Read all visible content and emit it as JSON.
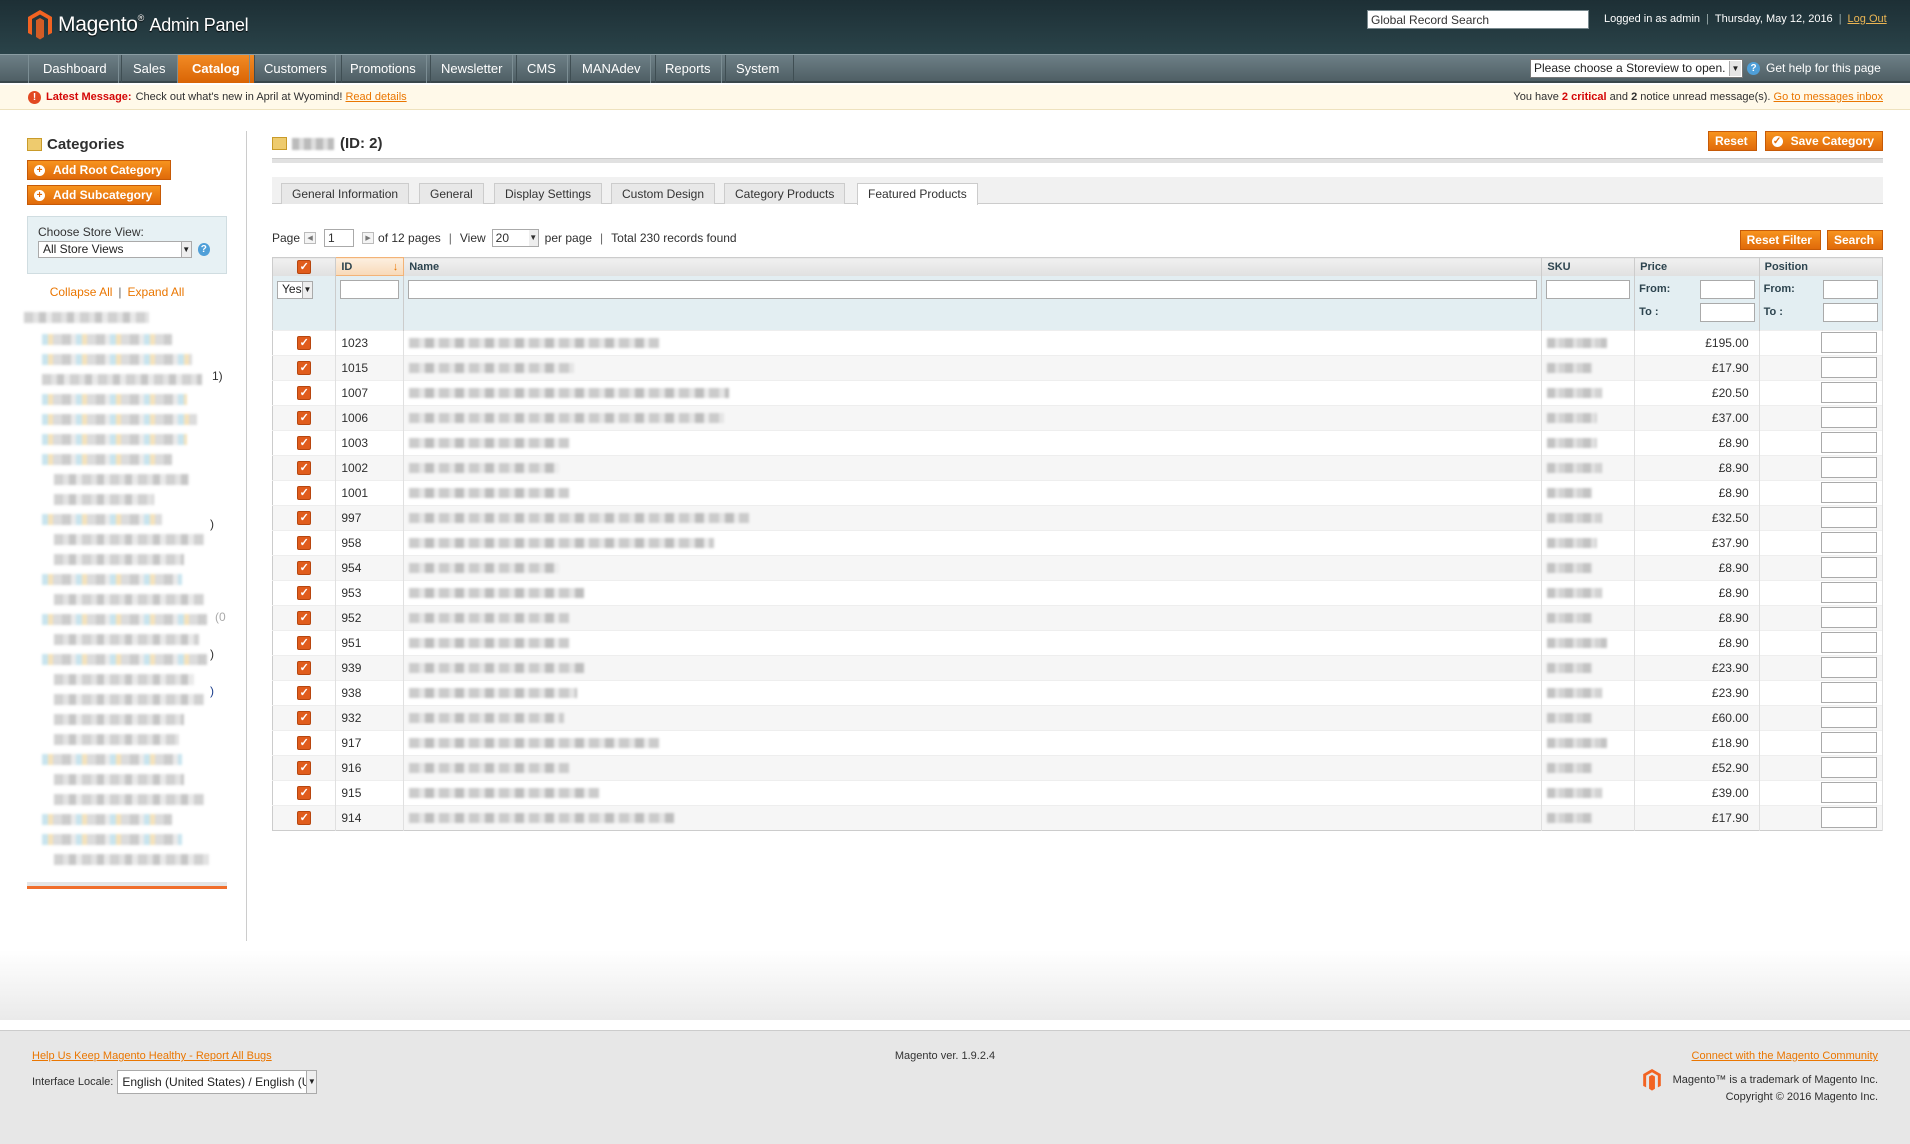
{
  "header": {
    "logo_text": "Magento",
    "logo_sub": "Admin Panel",
    "search_value": "Global Record Search",
    "logged_in": "Logged in as admin",
    "date": "Thursday, May 12, 2016",
    "logout": "Log Out"
  },
  "nav": {
    "items": [
      "Dashboard",
      "Sales",
      "Catalog",
      "Customers",
      "Promotions",
      "Newsletter",
      "CMS",
      "MANAdev",
      "Reports",
      "System"
    ],
    "active": "Catalog",
    "store_select": "Please choose a Storeview to open.",
    "help": "Get help for this page"
  },
  "notice": {
    "label": "Latest Message:",
    "text": "Check out what's new in April at Wyomind!",
    "link": "Read details",
    "right_pre": "You have",
    "critical_count": "2",
    "critical": "critical",
    "and": "and",
    "notice_count": "2",
    "right_post": "notice unread message(s).",
    "inbox_link": "Go to messages inbox"
  },
  "sidebar": {
    "title": "Categories",
    "add_root": "Add Root Category",
    "add_sub": "Add Subcategory",
    "store_label": "Choose Store View:",
    "store_value": "All Store Views",
    "collapse": "Collapse All",
    "expand": "Expand All",
    "tree_suffixes": [
      "1)",
      ")",
      "(0",
      ")",
      ")"
    ]
  },
  "main": {
    "title_id": "(ID: 2)",
    "reset": "Reset",
    "save": "Save Category",
    "tabs": [
      "General Information",
      "General",
      "Display Settings",
      "Custom Design",
      "Category Products",
      "Featured Products"
    ],
    "active_tab": "Featured Products"
  },
  "pager": {
    "page_label": "Page",
    "page_value": "1",
    "of_pages": "of 12 pages",
    "view_label": "View",
    "view_value": "20",
    "per_page": "per page",
    "total": "Total 230 records found",
    "reset_filter": "Reset Filter",
    "search": "Search"
  },
  "grid": {
    "columns": {
      "id": "ID",
      "name": "Name",
      "sku": "SKU",
      "price": "Price",
      "position": "Position"
    },
    "filter_yes": "Yes",
    "from": "From:",
    "to": "To :",
    "rows": [
      {
        "id": "1023",
        "price": "£195.00",
        "nw": 250,
        "sw": 60
      },
      {
        "id": "1015",
        "price": "£17.90",
        "nw": 165,
        "sw": 45
      },
      {
        "id": "1007",
        "price": "£20.50",
        "nw": 320,
        "sw": 55
      },
      {
        "id": "1006",
        "price": "£37.00",
        "nw": 315,
        "sw": 50
      },
      {
        "id": "1003",
        "price": "£8.90",
        "nw": 160,
        "sw": 50
      },
      {
        "id": "1002",
        "price": "£8.90",
        "nw": 150,
        "sw": 55
      },
      {
        "id": "1001",
        "price": "£8.90",
        "nw": 160,
        "sw": 45
      },
      {
        "id": "997",
        "price": "£32.50",
        "nw": 340,
        "sw": 55
      },
      {
        "id": "958",
        "price": "£37.90",
        "nw": 305,
        "sw": 50
      },
      {
        "id": "954",
        "price": "£8.90",
        "nw": 150,
        "sw": 45
      },
      {
        "id": "953",
        "price": "£8.90",
        "nw": 175,
        "sw": 55
      },
      {
        "id": "952",
        "price": "£8.90",
        "nw": 160,
        "sw": 45
      },
      {
        "id": "951",
        "price": "£8.90",
        "nw": 160,
        "sw": 60
      },
      {
        "id": "939",
        "price": "£23.90",
        "nw": 175,
        "sw": 45
      },
      {
        "id": "938",
        "price": "£23.90",
        "nw": 168,
        "sw": 55
      },
      {
        "id": "932",
        "price": "£60.00",
        "nw": 155,
        "sw": 45
      },
      {
        "id": "917",
        "price": "£18.90",
        "nw": 250,
        "sw": 60
      },
      {
        "id": "916",
        "price": "£52.90",
        "nw": 160,
        "sw": 45
      },
      {
        "id": "915",
        "price": "£39.00",
        "nw": 190,
        "sw": 55
      },
      {
        "id": "914",
        "price": "£17.90",
        "nw": 265,
        "sw": 45
      }
    ]
  },
  "footer": {
    "bugs": "Help Us Keep Magento Healthy - Report All Bugs",
    "locale_label": "Interface Locale:",
    "locale_value": "English (United States) / English (U",
    "version": "Magento ver. 1.9.2.4",
    "community": "Connect with the Magento Community",
    "trademark": "Magento™ is a trademark of Magento Inc.",
    "copyright": "Copyright © 2016 Magento Inc."
  },
  "colors": {
    "accent": "#ea7601",
    "header": "#1d2f35",
    "nav": "#5b6c72"
  }
}
